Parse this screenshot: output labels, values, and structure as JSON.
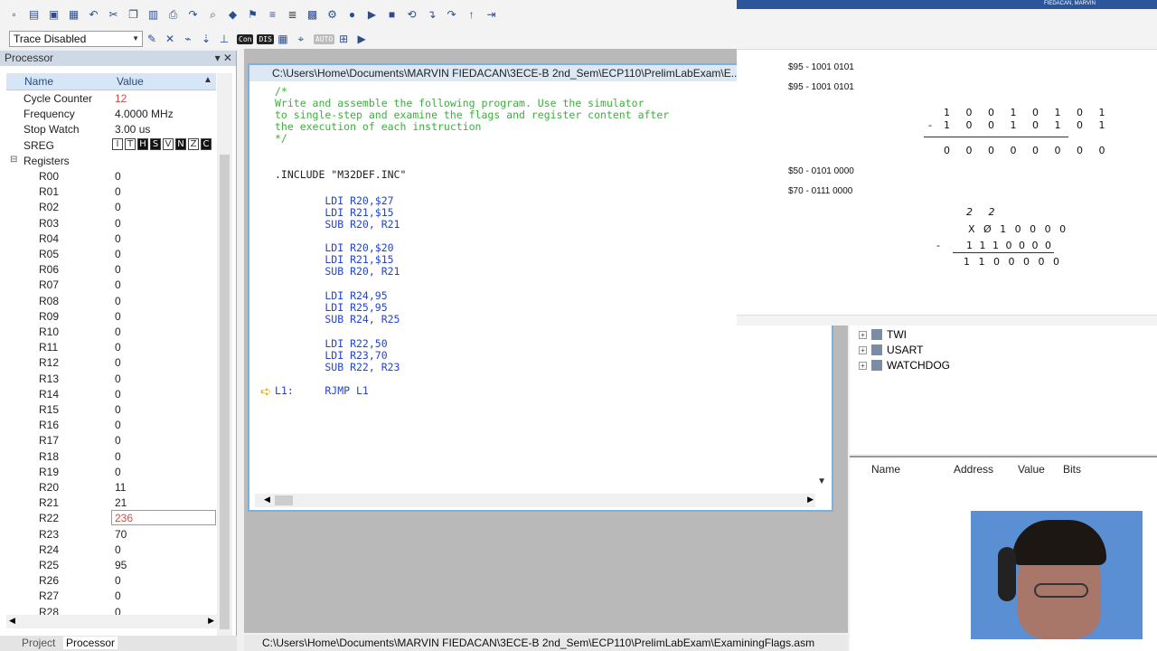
{
  "toolbar": {
    "trace_mode": "Trace Disabled",
    "badges": [
      "Con",
      "DIS",
      "AUTO"
    ]
  },
  "processor": {
    "title": "Processor",
    "col_name": "Name",
    "col_value": "Value",
    "cycle_counter_label": "Cycle Counter",
    "cycle_counter": "12",
    "frequency_label": "Frequency",
    "frequency": "4.0000 MHz",
    "stop_watch_label": "Stop Watch",
    "stop_watch": "3.00 us",
    "sreg_label": "SREG",
    "sreg_flags": [
      {
        "f": "I",
        "on": false
      },
      {
        "f": "T",
        "on": false
      },
      {
        "f": "H",
        "on": true
      },
      {
        "f": "S",
        "on": true
      },
      {
        "f": "V",
        "on": false
      },
      {
        "f": "N",
        "on": true
      },
      {
        "f": "Z",
        "on": false
      },
      {
        "f": "C",
        "on": true
      }
    ],
    "registers_label": "Registers",
    "registers": [
      {
        "name": "R00",
        "value": "0"
      },
      {
        "name": "R01",
        "value": "0"
      },
      {
        "name": "R02",
        "value": "0"
      },
      {
        "name": "R03",
        "value": "0"
      },
      {
        "name": "R04",
        "value": "0"
      },
      {
        "name": "R05",
        "value": "0"
      },
      {
        "name": "R06",
        "value": "0"
      },
      {
        "name": "R07",
        "value": "0"
      },
      {
        "name": "R08",
        "value": "0"
      },
      {
        "name": "R09",
        "value": "0"
      },
      {
        "name": "R10",
        "value": "0"
      },
      {
        "name": "R11",
        "value": "0"
      },
      {
        "name": "R12",
        "value": "0"
      },
      {
        "name": "R13",
        "value": "0"
      },
      {
        "name": "R14",
        "value": "0"
      },
      {
        "name": "R15",
        "value": "0"
      },
      {
        "name": "R16",
        "value": "0"
      },
      {
        "name": "R17",
        "value": "0"
      },
      {
        "name": "R18",
        "value": "0"
      },
      {
        "name": "R19",
        "value": "0"
      },
      {
        "name": "R20",
        "value": "11"
      },
      {
        "name": "R21",
        "value": "21"
      },
      {
        "name": "R22",
        "value": "236",
        "changed": true
      },
      {
        "name": "R23",
        "value": "70"
      },
      {
        "name": "R24",
        "value": "0"
      },
      {
        "name": "R25",
        "value": "95"
      },
      {
        "name": "R26",
        "value": "0"
      },
      {
        "name": "R27",
        "value": "0"
      },
      {
        "name": "R28",
        "value": "0"
      }
    ],
    "tabs": [
      "Project",
      "Processor"
    ]
  },
  "editor": {
    "title": "C:\\Users\\Home\\Documents\\MARVIN FIEDACAN\\3ECE-B 2nd_Sem\\ECP110\\PrelimLabExam\\E...",
    "lines": [
      {
        "t": "/*",
        "c": "cmt"
      },
      {
        "t": "Write and assemble the following program. Use the simulator",
        "c": "cmt"
      },
      {
        "t": "to single-step and examine the flags and register content after",
        "c": "cmt"
      },
      {
        "t": "the execution of each instruction",
        "c": "cmt"
      },
      {
        "t": "*/",
        "c": "cmt"
      },
      {
        "t": "",
        "c": "plain"
      },
      {
        "t": ".INCLUDE \"M32DEF.INC\"",
        "c": "plain"
      },
      {
        "t": "",
        "c": "plain"
      },
      {
        "t": "        LDI R20,$27",
        "c": "kw"
      },
      {
        "t": "        LDI R21,$15",
        "c": "kw"
      },
      {
        "t": "        SUB R20, R21",
        "c": "kw"
      },
      {
        "t": "",
        "c": "plain"
      },
      {
        "t": "        LDI R20,$20",
        "c": "kw"
      },
      {
        "t": "        LDI R21,$15",
        "c": "kw"
      },
      {
        "t": "        SUB R20, R21",
        "c": "kw"
      },
      {
        "t": "",
        "c": "plain"
      },
      {
        "t": "        LDI R24,95",
        "c": "kw"
      },
      {
        "t": "        LDI R25,95",
        "c": "kw"
      },
      {
        "t": "        SUB R24, R25",
        "c": "kw"
      },
      {
        "t": "",
        "c": "plain"
      },
      {
        "t": "        LDI R22,50",
        "c": "kw"
      },
      {
        "t": "        LDI R23,70",
        "c": "kw"
      },
      {
        "t": "        SUB R22, R23",
        "c": "kw"
      },
      {
        "t": "",
        "c": "plain"
      },
      {
        "t": "L1:     RJMP L1",
        "c": "mixed"
      }
    ]
  },
  "status_bar": {
    "path": "C:\\Users\\Home\\Documents\\MARVIN FIEDACAN\\3ECE-B 2nd_Sem\\ECP110\\PrelimLabExam\\ExaminingFlags.asm"
  },
  "word_doc": {
    "user": "FIEDACAN, MARVIN",
    "lines_text": [
      "$95 - 1001 0101",
      "$95 - 1001 0101",
      "$50 - 0101 0000",
      "$70 - 0111 0000"
    ],
    "calc1_row1": "1 0 0 1 0 1 0 1",
    "calc1_row2": "1 0 0 1 0 1 0 1",
    "calc1_result": "0 0 0 0 0 0 0 0",
    "calc2_carry": "2 2",
    "calc2_row1": "X Ø 1 0 0 0 0",
    "calc2_row2": "1 1 1 0 0 0 0",
    "calc2_result": "1 1 0 0 0 0 0",
    "minus": "-"
  },
  "io_tree": {
    "items": [
      "TWI",
      "USART",
      "WATCHDOG"
    ]
  },
  "io_table": {
    "col_name": "Name",
    "col_address": "Address",
    "col_value": "Value",
    "col_bits": "Bits"
  }
}
